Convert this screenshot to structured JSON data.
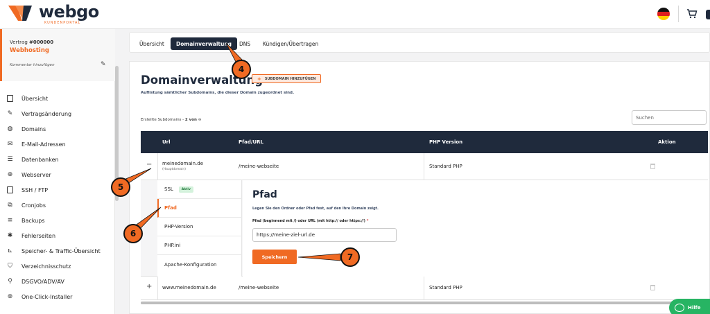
{
  "brand": {
    "name": "webgo",
    "tagline": "KUNDENPORTAL",
    "accent": "#f06a23",
    "dark": "#1f2a3c"
  },
  "header": {
    "language_flag": "flag-de-icon",
    "cart_icon": "cart-icon"
  },
  "sidebar": {
    "contract_label": "Vertrag",
    "contract_number": "#000000",
    "plan": "Webhosting",
    "comment": "Kommentar hinzufügen",
    "items": [
      {
        "label": "Übersicht",
        "icon": "file-icon"
      },
      {
        "label": "Vertragsänderung",
        "icon": "edit-icon"
      },
      {
        "label": "Domains",
        "icon": "globe-icon"
      },
      {
        "label": "E-Mail-Adressen",
        "icon": "mail-icon"
      },
      {
        "label": "Datenbanken",
        "icon": "database-icon"
      },
      {
        "label": "Webserver",
        "icon": "server-icon"
      },
      {
        "label": "SSH / FTP",
        "icon": "terminal-icon"
      },
      {
        "label": "Cronjobs",
        "icon": "clock-icon"
      },
      {
        "label": "Backups",
        "icon": "stack-icon"
      },
      {
        "label": "Fehlerseiten",
        "icon": "bug-icon"
      },
      {
        "label": "Speicher- & Traffic-Übersicht",
        "icon": "chart-icon"
      },
      {
        "label": "Verzeichnisschutz",
        "icon": "shield-icon"
      },
      {
        "label": "DSGVO/ADV/AV",
        "icon": "user-key-icon"
      },
      {
        "label": "One-Click-Installer",
        "icon": "download-icon"
      }
    ]
  },
  "tabs": [
    {
      "label": "Übersicht"
    },
    {
      "label": "Domainverwaltung"
    },
    {
      "label": "DNS"
    },
    {
      "label": "Kündigen/Übertragen"
    }
  ],
  "main": {
    "title": "Domainverwaltung",
    "add_subdomain": "SUBDOMAIN HINZUFÜGEN",
    "description": "Auflistung sämtlicher Subdomains, die dieser Domain zugeordnet sind.",
    "count_label": "Erstellte Subdomains -",
    "count_value": "2 von ∞",
    "search_placeholder": "Suchen"
  },
  "table": {
    "columns": [
      "Url",
      "Pfad/URL",
      "PHP Version",
      "Aktion"
    ],
    "rows": [
      {
        "toggle": "−",
        "url": "meinedomain.de",
        "note": "(Hauptdomain)",
        "path": "/meine-webseite",
        "php": "Standard PHP"
      },
      {
        "toggle": "+",
        "url": "www.meinedomain.de",
        "note": "",
        "path": "/meine-webseite",
        "php": "Standard PHP"
      }
    ]
  },
  "detail": {
    "menu": [
      {
        "label": "SSL",
        "badge": "Aktiv"
      },
      {
        "label": "Pfad"
      },
      {
        "label": "PHP-Version"
      },
      {
        "label": "PHP.ini"
      },
      {
        "label": "Apache-Konfiguration"
      }
    ],
    "form_title": "Pfad",
    "form_desc": "Legen Sie den Ordner oder Pfad fest, auf den Ihre Domain zeigt.",
    "input_label": "Pfad (beginnend mit /) oder URL (mit http:// oder https://)",
    "required_mark": "*",
    "input_value": "https://meine-ziel-url.de",
    "save_label": "Speichern"
  },
  "callouts": [
    "4",
    "5",
    "6",
    "7"
  ],
  "help": {
    "label": "Hilfe"
  }
}
